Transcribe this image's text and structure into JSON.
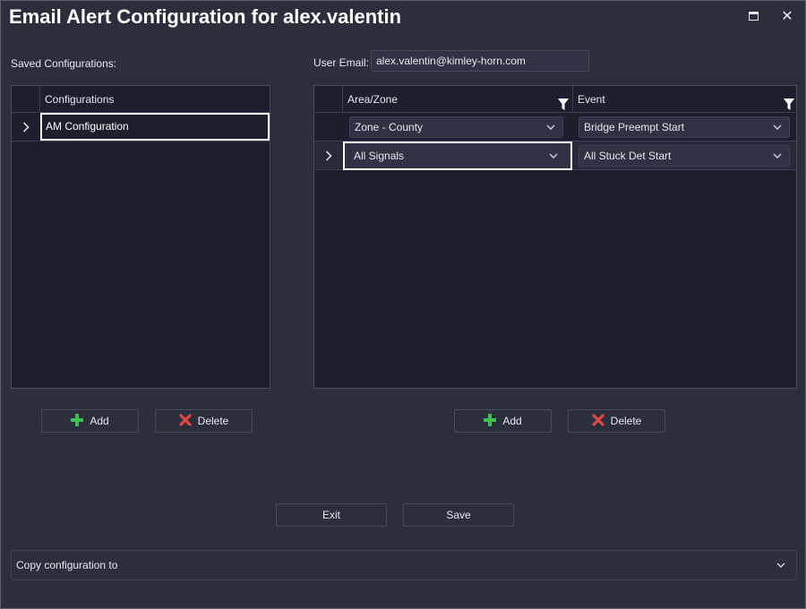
{
  "window": {
    "title": "Email Alert Configuration for alex.valentin",
    "close_glyph": "✕"
  },
  "saved": {
    "label": "Saved Configurations:",
    "header": "Configurations",
    "rows": [
      {
        "name": "AM Configuration"
      }
    ],
    "add_label": "Add",
    "delete_label": "Delete"
  },
  "user": {
    "email_label": "User Email:",
    "email_value": "alex.valentin@kimley-horn.com"
  },
  "alerts": {
    "headers": {
      "area": "Area/Zone",
      "event": "Event"
    },
    "rows": [
      {
        "area": "Zone - County",
        "event": "Bridge Preempt Start"
      },
      {
        "area": "All Signals",
        "event": "All Stuck Det Start"
      }
    ],
    "add_label": "Add",
    "delete_label": "Delete"
  },
  "footer": {
    "exit_label": "Exit",
    "save_label": "Save",
    "copy_label": "Copy configuration to"
  },
  "icons": {
    "row_indicator": "chevron-right-icon",
    "dropdown": "chevron-down-icon",
    "filter": "funnel-icon",
    "add": "plus-icon",
    "delete": "x-icon"
  },
  "colors": {
    "background": "#2b2e3b",
    "grid": "#1c1f2d",
    "add_green": "#3fbf4f",
    "delete_red": "#e04848"
  }
}
